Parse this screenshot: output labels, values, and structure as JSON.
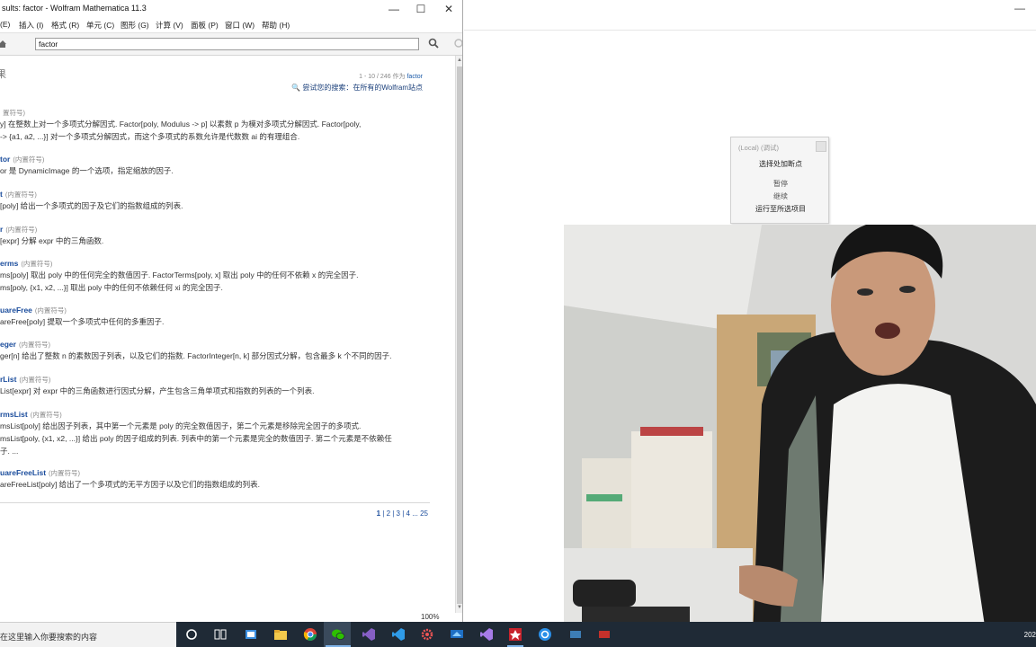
{
  "window": {
    "title": "sults: factor - Wolfram Mathematica 11.3",
    "minimize": "—",
    "maximize": "☐",
    "close": "✕"
  },
  "menu": [
    "(E)",
    "插入 (I)",
    "格式 (R)",
    "单元 (C)",
    "图形 (G)",
    "计算 (V)",
    "面板 (P)",
    "窗口 (W)",
    "帮助 (H)"
  ],
  "search": {
    "value": "factor"
  },
  "results": {
    "heading": "果",
    "range_prefix": "1 - 10 / 246 作为 ",
    "range_keyword": "factor",
    "try_label": "尝试您的搜索：",
    "try_link": "在所有的Wolfram站点"
  },
  "entries": [
    {
      "name": "",
      "type": "置符号)",
      "desc": [
        "y] 在整数上对一个多项式分解因式. Factor[poly, Modulus -> p] 以素数 p 为模对多项式分解因式. Factor[poly,",
        "-> {a1, a2, ...}] 对一个多项式分解因式，而这个多项式的系数允许是代数数 ai 的有理组合."
      ]
    },
    {
      "name": "tor",
      "type": "(内置符号)",
      "desc": [
        "or 是 DynamicImage 的一个选项，指定缩放的因子."
      ]
    },
    {
      "name": "t",
      "type": "(内置符号)",
      "desc": [
        "[poly] 给出一个多项式的因子及它们的指数组成的列表."
      ]
    },
    {
      "name": "r",
      "type": "(内置符号)",
      "desc": [
        "[expr] 分解 expr 中的三角函数."
      ]
    },
    {
      "name": "erms",
      "type": "(内置符号)",
      "desc": [
        "ms[poly] 取出 poly 中的任何完全的数值因子. FactorTerms[poly, x] 取出 poly 中的任何不依赖 x 的完全因子.",
        "ms[poly, {x1, x2, ...}] 取出 poly 中的任何不依赖任何 xi 的完全因子."
      ]
    },
    {
      "name": "uareFree",
      "type": "(内置符号)",
      "desc": [
        "areFree[poly] 提取一个多项式中任何的多重因子."
      ]
    },
    {
      "name": "eger",
      "type": "(内置符号)",
      "desc": [
        "ger[n] 给出了整数 n 的素数因子列表，以及它们的指数. FactorInteger[n, k] 部分因式分解，包含最多 k 个不同的因子."
      ]
    },
    {
      "name": "rList",
      "type": "(内置符号)",
      "desc": [
        "List[expr] 对 expr 中的三角函数进行因式分解，产生包含三角单项式和指数的列表的一个列表."
      ]
    },
    {
      "name": "rmsList",
      "type": "(内置符号)",
      "desc": [
        "msList[poly] 给出因子列表，其中第一个元素是 poly 的完全数值因子，第二个元素是移除完全因子的多项式.",
        "msList[poly, {x1, x2, ...}] 给出 poly 的因子组成的列表. 列表中的第一个元素是完全的数值因子. 第二个元素是不依赖任",
        "子. ..."
      ]
    },
    {
      "name": "uareFreeList",
      "type": "(内置符号)",
      "desc": [
        "areFreeList[poly] 给出了一个多项式的无平方因子以及它们的指数组成的列表."
      ]
    }
  ],
  "pager": {
    "current": "1",
    "rest": " | 2 | 3 | 4 ... 25"
  },
  "zoom": "100%",
  "debugger": {
    "title": "(Local) (调试)",
    "items": [
      "选择处加断点",
      "暂停",
      "继续",
      "运行至所选项目"
    ]
  },
  "taskbar": {
    "search_placeholder": "在这里输入你要搜索的内容",
    "clock": "202"
  },
  "colors": {
    "link": "#1a4c9c",
    "taskbar": "#1f2a36"
  }
}
